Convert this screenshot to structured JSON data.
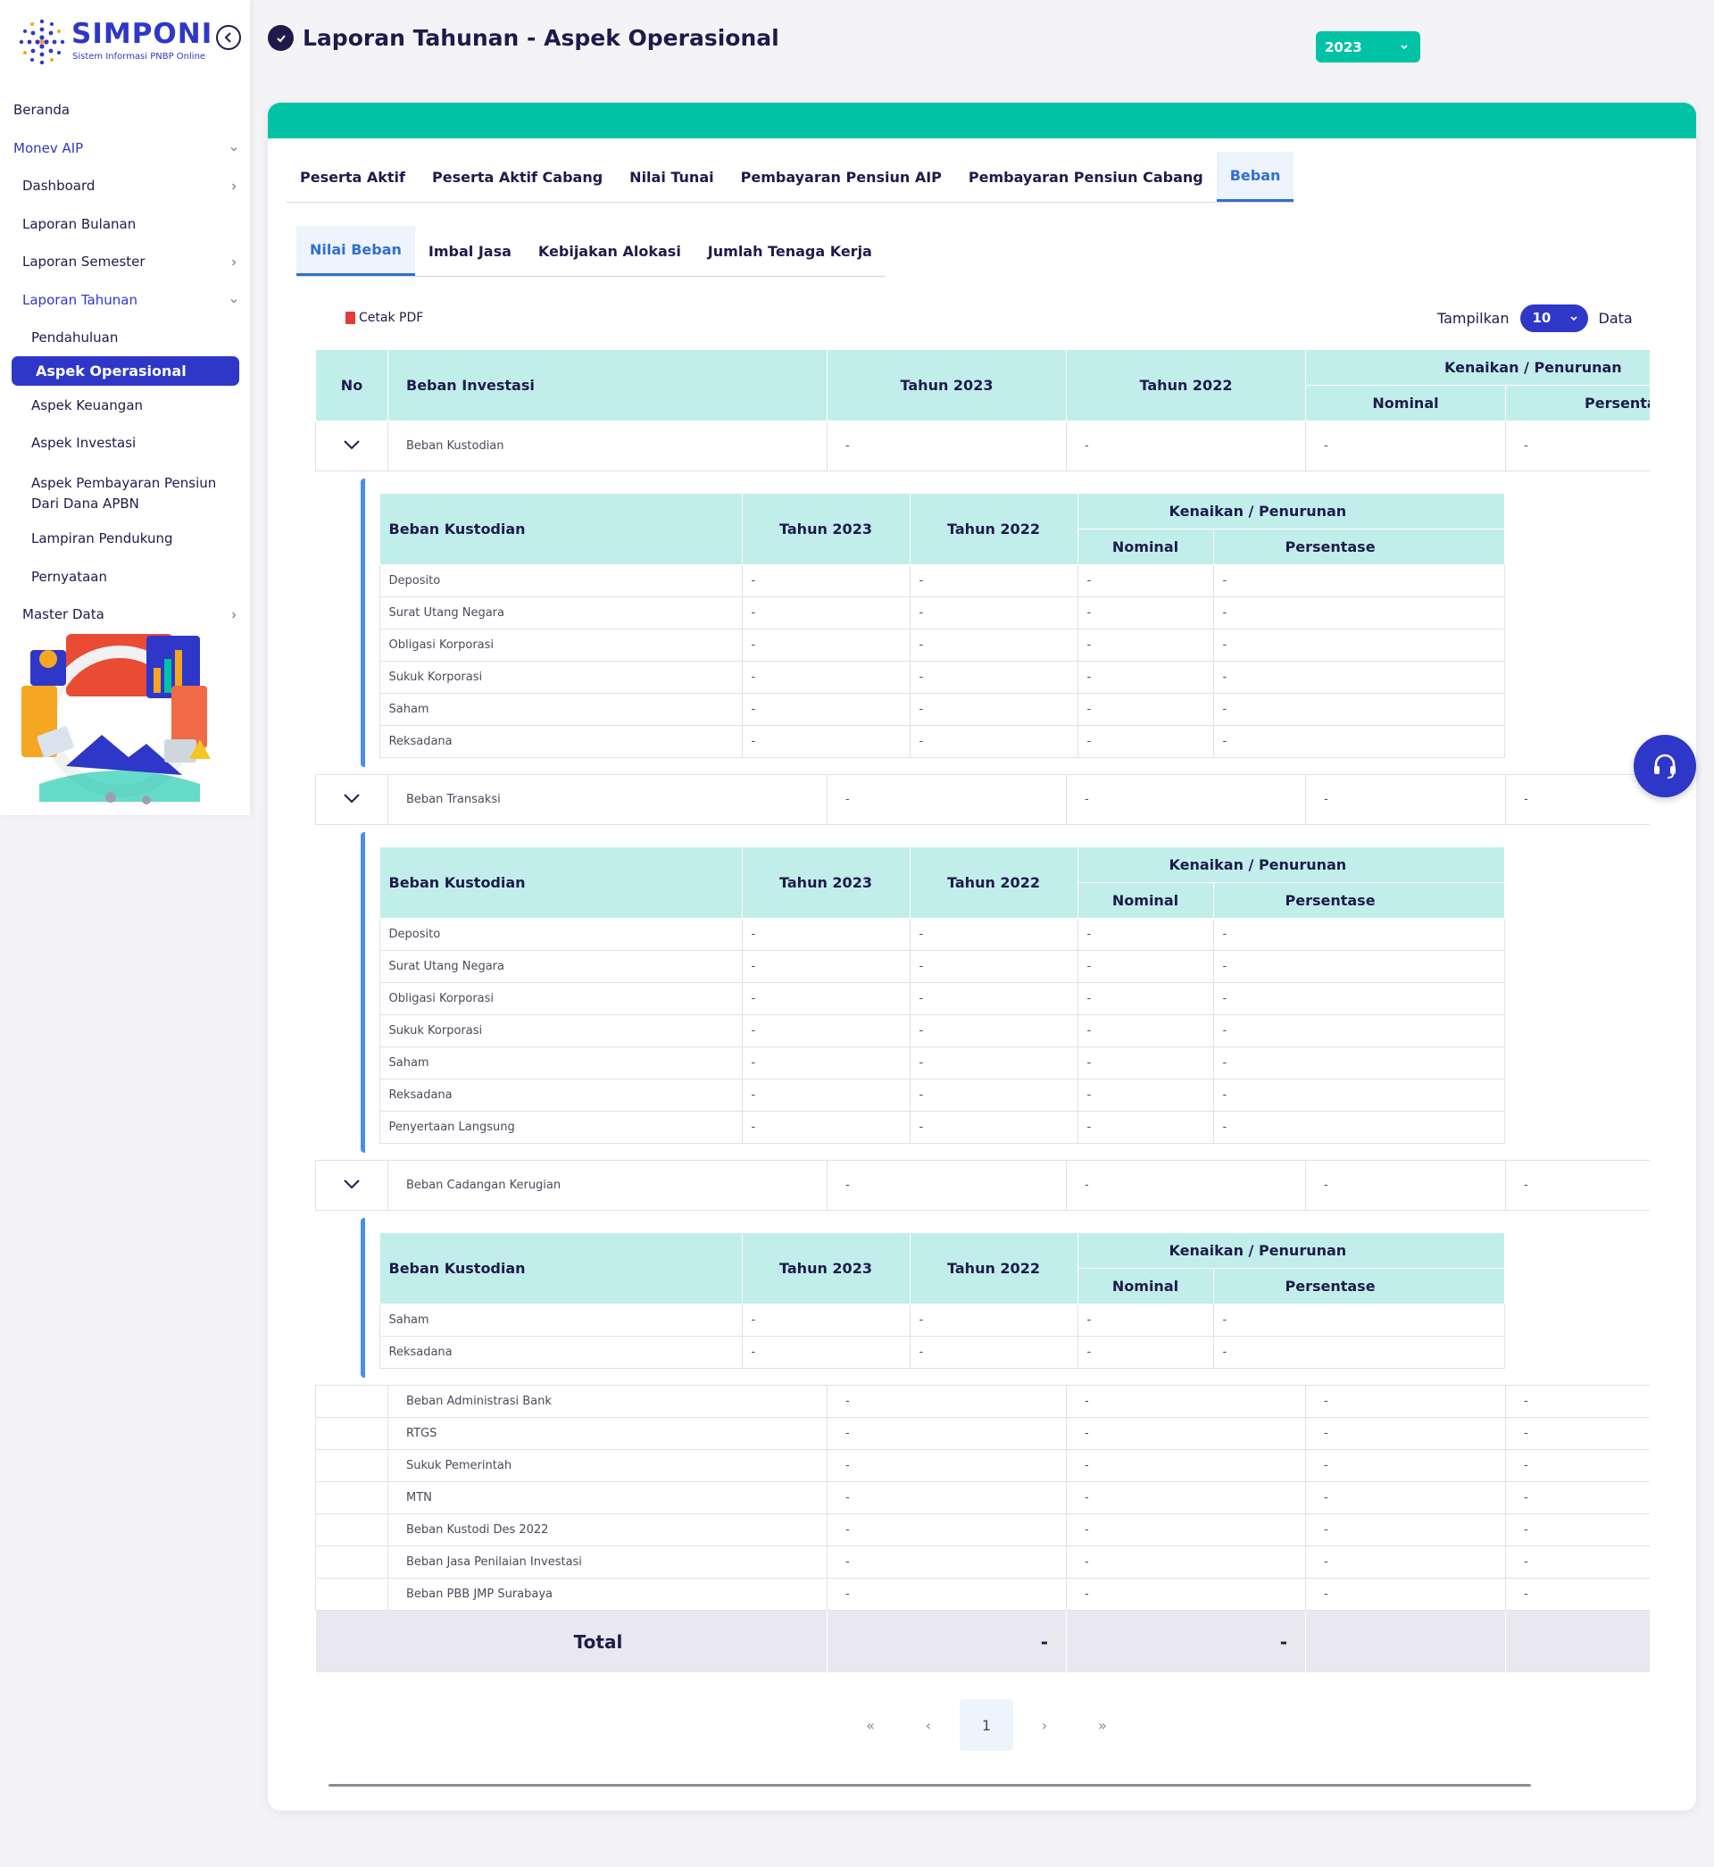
{
  "app": {
    "logo_title": "SIMPONI",
    "logo_subtitle": "Sistem Informasi PNBP Online"
  },
  "sidebar": {
    "items": [
      {
        "label": "Beranda"
      },
      {
        "label": "Monev AIP"
      },
      {
        "label": "Dashboard"
      },
      {
        "label": "Laporan Bulanan"
      },
      {
        "label": "Laporan Semester"
      },
      {
        "label": "Laporan Tahunan"
      },
      {
        "label": "Pendahuluan"
      },
      {
        "label": "Aspek Operasional"
      },
      {
        "label": "Aspek Keuangan"
      },
      {
        "label": "Aspek Investasi"
      },
      {
        "label": "Aspek Pembayaran Pensiun Dari Dana APBN"
      },
      {
        "label": "Lampiran Pendukung"
      },
      {
        "label": "Pernyataan"
      },
      {
        "label": "Master Data"
      }
    ]
  },
  "header": {
    "title": "Laporan Tahunan - Aspek Operasional",
    "year": "2023"
  },
  "tabs": [
    "Peserta Aktif",
    "Peserta Aktif Cabang",
    "Nilai Tunai",
    "Pembayaran Pensiun AIP",
    "Pembayaran Pensiun Cabang",
    "Beban"
  ],
  "subtabs": [
    "Nilai Beban",
    "Imbal Jasa",
    "Kebijakan Alokasi",
    "Jumlah Tenaga Kerja"
  ],
  "toolbar": {
    "cetak_pdf": "Cetak PDF",
    "tampilkan": "Tampilkan",
    "per_page": "10",
    "data": "Data"
  },
  "table": {
    "headers": {
      "no": "No",
      "beban_investasi": "Beban Investasi",
      "tahun_2023": "Tahun 2023",
      "tahun_2022": "Tahun 2022",
      "kenaikan": "Kenaikan / Penurunan",
      "nominal": "Nominal",
      "persentase_cut": "Persenta",
      "persentase": "Persentase"
    },
    "sub_header_title": "Beban Kustodian",
    "dash": "-",
    "groups": [
      {
        "name": "Beban Kustodian",
        "items": [
          "Deposito",
          "Surat Utang Negara",
          "Obligasi Korporasi",
          "Sukuk Korporasi",
          "Saham",
          "Reksadana"
        ]
      },
      {
        "name": "Beban Transaksi",
        "items": [
          "Deposito",
          "Surat Utang Negara",
          "Obligasi Korporasi",
          "Sukuk Korporasi",
          "Saham",
          "Reksadana",
          "Penyertaan Langsung"
        ]
      },
      {
        "name": "Beban Cadangan Kerugian",
        "items": [
          "Saham",
          "Reksadana"
        ]
      }
    ],
    "flat_rows": [
      "Beban Administrasi Bank",
      "RTGS",
      "Sukuk Pemerintah",
      "MTN",
      "Beban Kustodi Des 2022",
      "Beban Jasa Penilaian Investasi",
      "Beban PBB JMP Surabaya"
    ],
    "total_label": "Total",
    "total_2023": "-",
    "total_2022": "-"
  },
  "pagination": {
    "first": "«",
    "prev": "‹",
    "current": "1",
    "next": "›",
    "last": "»"
  },
  "colors": {
    "primary": "#2f37c9",
    "teal": "#00c3a5",
    "header_bg": "#c1eeea",
    "accent_blue": "#2f6fd6"
  }
}
